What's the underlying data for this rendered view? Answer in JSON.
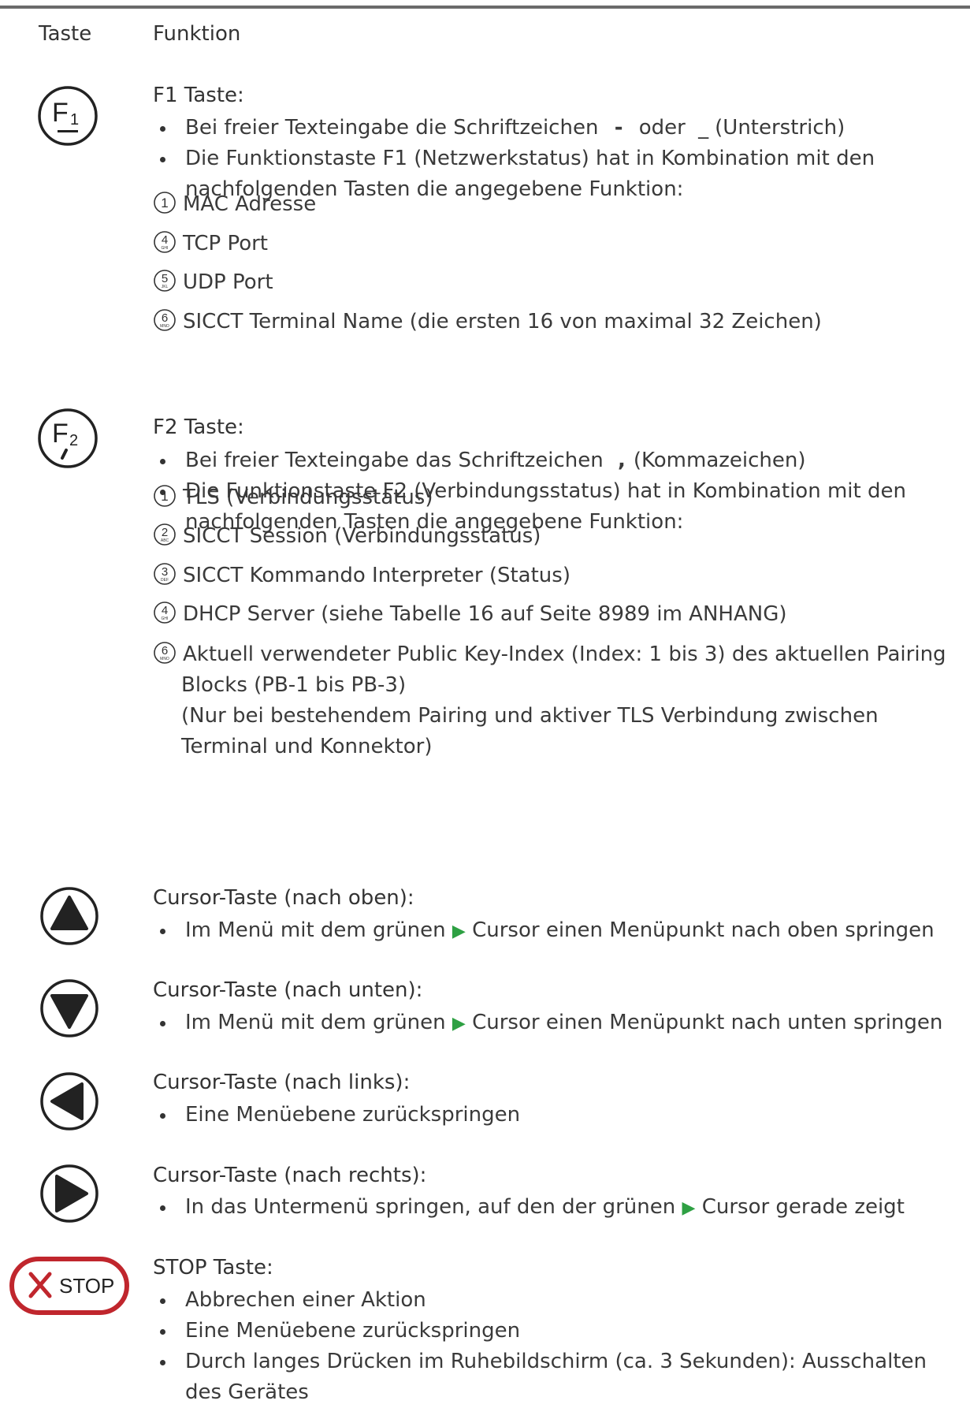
{
  "header": {
    "col_key": "Taste",
    "col_function": "Funktion"
  },
  "f1": {
    "title": "F1 Taste:",
    "bullet1_pre": "Bei freier Texteingabe die Schriftzeichen",
    "bullet1_sym1": "-",
    "bullet1_mid": "oder",
    "bullet1_sym2": "_",
    "bullet1_post": "(Unterstrich)",
    "bullet2": "Die Funktionstaste F1 (Netzwerkstatus) hat in Kombination mit den nachfolgenden Tasten die angegebene Funktion:",
    "items": [
      {
        "num": "1",
        "letters": "",
        "text": "MAC Adresse"
      },
      {
        "num": "4",
        "letters": "GHI",
        "text": "TCP Port"
      },
      {
        "num": "5",
        "letters": "JKL",
        "text": "UDP Port"
      },
      {
        "num": "6",
        "letters": "MNO",
        "text": "SICCT Terminal Name (die ersten 16 von maximal 32 Zeichen)"
      }
    ]
  },
  "f2": {
    "title": "F2 Taste:",
    "bullet1_pre": "Bei freier Texteingabe das Schriftzeichen",
    "bullet1_sym": ",",
    "bullet1_post": "(Kommazeichen)",
    "bullet2": "Die Funktionstaste F2 (Verbindungsstatus) hat in Kombination mit den nachfolgenden Tasten die angegebene Funktion:",
    "items": [
      {
        "num": "1",
        "letters": "",
        "text": "TLS (Verbindungsstatus)"
      },
      {
        "num": "2",
        "letters": "ABC",
        "text": "SICCT Session (Verbindungsstatus)"
      },
      {
        "num": "3",
        "letters": "DEF",
        "text": "SICCT Kommando Interpreter (Status)"
      },
      {
        "num": "4",
        "letters": "GHI",
        "text": "DHCP Server (siehe Tabelle 16 auf Seite 8989 im ANHANG)"
      },
      {
        "num": "6",
        "letters": "MNO",
        "text": "Aktuell verwendeter Public Key-Index (Index: 1 bis 3) des aktuellen Pairing",
        "cont1": "Blocks (PB-1 bis PB-3)",
        "cont2": "(Nur bei bestehendem Pairing und aktiver TLS Verbindung zwischen",
        "cont3": "Terminal und Konnektor)"
      }
    ]
  },
  "up": {
    "title": "Cursor-Taste (nach oben):",
    "pre": "Im Menü mit dem grünen",
    "post": "Cursor einen Menüpunkt nach oben springen"
  },
  "down": {
    "title": "Cursor-Taste (nach unten):",
    "pre": "Im Menü mit dem grünen",
    "post": "Cursor einen Menüpunkt nach unten springen"
  },
  "left": {
    "title": "Cursor-Taste (nach links):",
    "text": "Eine Menüebene zurückspringen"
  },
  "right": {
    "title": "Cursor-Taste (nach rechts):",
    "pre": "In das Untermenü springen, auf den der grünen",
    "post": "Cursor gerade zeigt"
  },
  "stop": {
    "label": "STOP",
    "title": "STOP Taste:",
    "b1": "Abbrechen einer Aktion",
    "b2": "Eine Menüebene zurückspringen",
    "b3": "Durch langes Drücken im Ruhebildschirm (ca. 3 Sekunden): Ausschalten des Gerätes"
  },
  "colors": {
    "cursor_triangle": "#2ea043",
    "stop_red": "#c0262d"
  }
}
